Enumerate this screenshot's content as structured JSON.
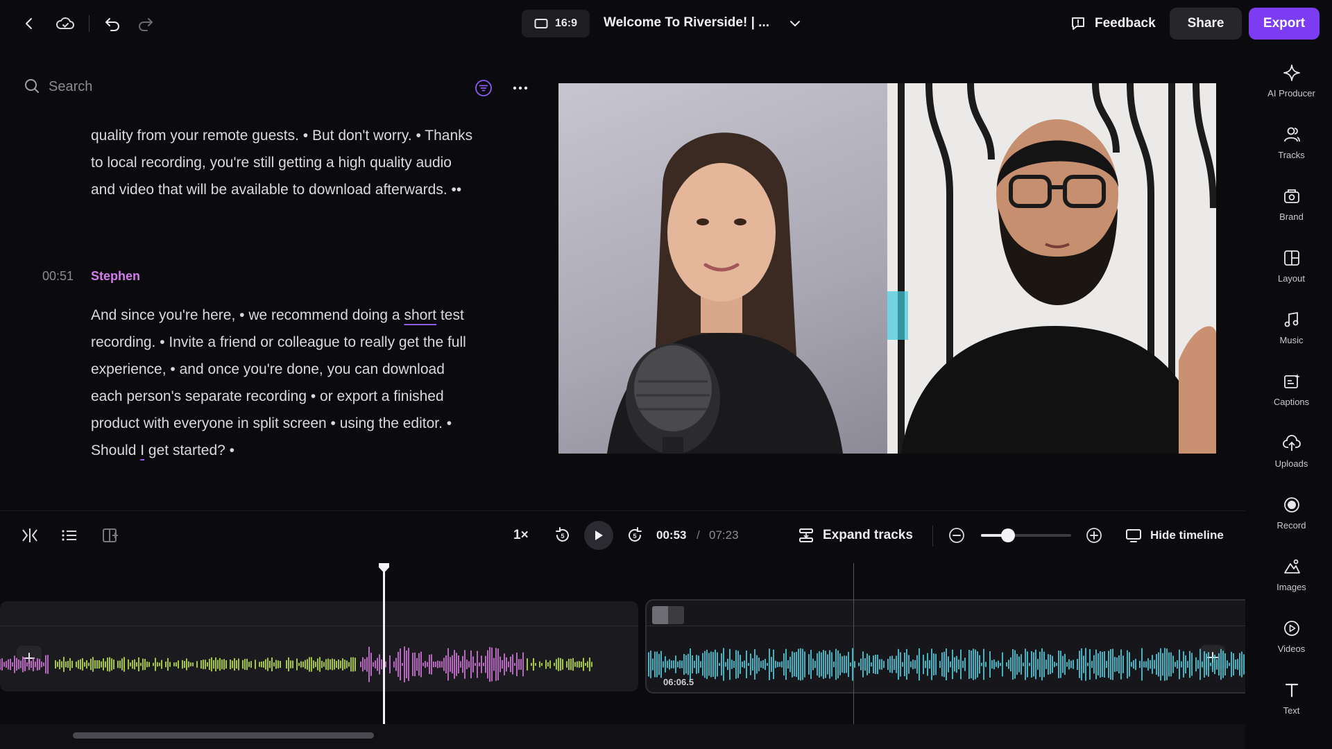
{
  "topbar": {
    "aspect_ratio": "16:9",
    "project_title": "Welcome To Riverside! | ...",
    "feedback_label": "Feedback",
    "share_label": "Share",
    "export_label": "Export",
    "accent_color": "#7b3cf2"
  },
  "search": {
    "placeholder": "Search"
  },
  "transcript": {
    "block1_text": "quality from your remote guests. • But don't worry. • Thanks to local recording, you're still getting a high quality audio and video that will be available to download afterwards. ••",
    "block2_timestamp": "00:51",
    "block2_speaker": "Stephen",
    "block2_text_before": "And since you're here, • we recommend doing a ",
    "block2_underlined": "short",
    "block2_text_mid": " test recording. • Invite a friend or colleague to really get the full experience, • and once you're done, you can download each person's separate recording • or export a finished product with everyone in split screen • using the editor. • Should ",
    "block2_underlined2": "I",
    "block2_text_after": " get started? •",
    "speaker_color": "#d57cf0"
  },
  "player": {
    "speed": "1×",
    "current_time": "00:53",
    "time_separator": "/",
    "total_time": "07:23",
    "expand_tracks_label": "Expand tracks",
    "hide_timeline_label": "Hide timeline",
    "zoom_level": 0.3
  },
  "timeline": {
    "clip2_time": "06:06.5",
    "track_colors": {
      "speaker_a": "#c7f24a",
      "speaker_b": "#e07ee8",
      "speaker_c": "#55d9ea"
    }
  },
  "rail": {
    "items": [
      {
        "label": "AI Producer",
        "icon": "sparkle-icon"
      },
      {
        "label": "Tracks",
        "icon": "people-icon"
      },
      {
        "label": "Brand",
        "icon": "brand-icon"
      },
      {
        "label": "Layout",
        "icon": "layout-icon"
      },
      {
        "label": "Music",
        "icon": "music-icon"
      },
      {
        "label": "Captions",
        "icon": "captions-icon"
      },
      {
        "label": "Uploads",
        "icon": "upload-icon"
      },
      {
        "label": "Record",
        "icon": "record-icon"
      },
      {
        "label": "Images",
        "icon": "images-icon"
      },
      {
        "label": "Videos",
        "icon": "videos-icon"
      },
      {
        "label": "Text",
        "icon": "text-icon"
      }
    ]
  }
}
